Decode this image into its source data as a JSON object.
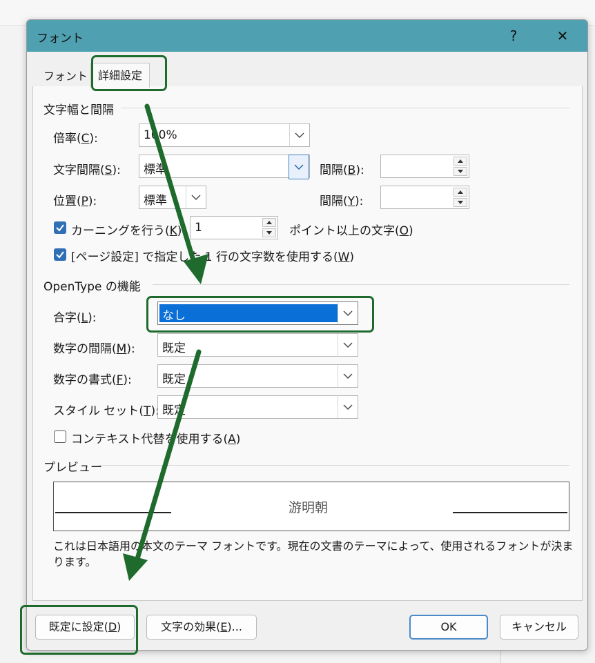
{
  "dialog": {
    "title": "フォント",
    "help_glyph": "?",
    "close_glyph": "✕"
  },
  "tabs": [
    {
      "label": "フォント",
      "active": false
    },
    {
      "label": "詳細設定",
      "active": true
    }
  ],
  "spacing_section": {
    "title": "文字幅と間隔",
    "scale": {
      "label_pre": "倍率(",
      "key": "C",
      "label_post": "):",
      "value": "100%"
    },
    "char_spacing": {
      "label_pre": "文字間隔(",
      "key": "S",
      "label_post": "):",
      "value": "標準"
    },
    "spacing_by": {
      "label_pre": "間隔(",
      "key": "B",
      "label_post": "):",
      "value": ""
    },
    "position": {
      "label_pre": "位置(",
      "key": "P",
      "label_post": "):",
      "value": "標準"
    },
    "position_by": {
      "label_pre": "間隔(",
      "key": "Y",
      "label_post": "):",
      "value": ""
    },
    "kerning": {
      "checked": true,
      "label_pre": "カーニングを行う(",
      "key": "K",
      "label_post": "):",
      "value": "1",
      "suffix_pre": "ポイント以上の文字(",
      "suffix_key": "O",
      "suffix_post": ")"
    },
    "grid": {
      "checked": true,
      "label_pre": "[ページ設定] で指定した 1 行の文字数を使用する(",
      "key": "W",
      "label_post": ")"
    }
  },
  "opentype_section": {
    "title": "OpenType の機能",
    "ligatures": {
      "label_pre": "合字(",
      "key": "L",
      "label_post": "):",
      "value": "なし"
    },
    "number_spacing": {
      "label_pre": "数字の間隔(",
      "key": "M",
      "label_post": "):",
      "value": "既定"
    },
    "number_forms": {
      "label_pre": "数字の書式(",
      "key": "F",
      "label_post": "):",
      "value": "既定"
    },
    "stylistic_sets": {
      "label_pre": "スタイル セット(",
      "key": "T",
      "label_post": "):",
      "value": "既定"
    },
    "contextual": {
      "checked": false,
      "label_pre": "コンテキスト代替を使用する(",
      "key": "A",
      "label_post": ")"
    }
  },
  "preview_section": {
    "title": "プレビュー",
    "sample_text": "游明朝",
    "description": "これは日本語用の本文のテーマ フォントです。現在の文書のテーマによって、使用されるフォントが決まります。"
  },
  "buttons": {
    "set_default": {
      "label_pre": "既定に設定(",
      "key": "D",
      "label_post": ")"
    },
    "text_effects": {
      "label_pre": "文字の効果(",
      "key": "E",
      "label_post": ")..."
    },
    "ok": "OK",
    "cancel": "キャンセル"
  },
  "colors": {
    "titlebar": "#4fa0b0",
    "selection": "#0a6fd6",
    "annotation": "#1e6b2d",
    "checkbox_checked": "#2f6fb5"
  }
}
